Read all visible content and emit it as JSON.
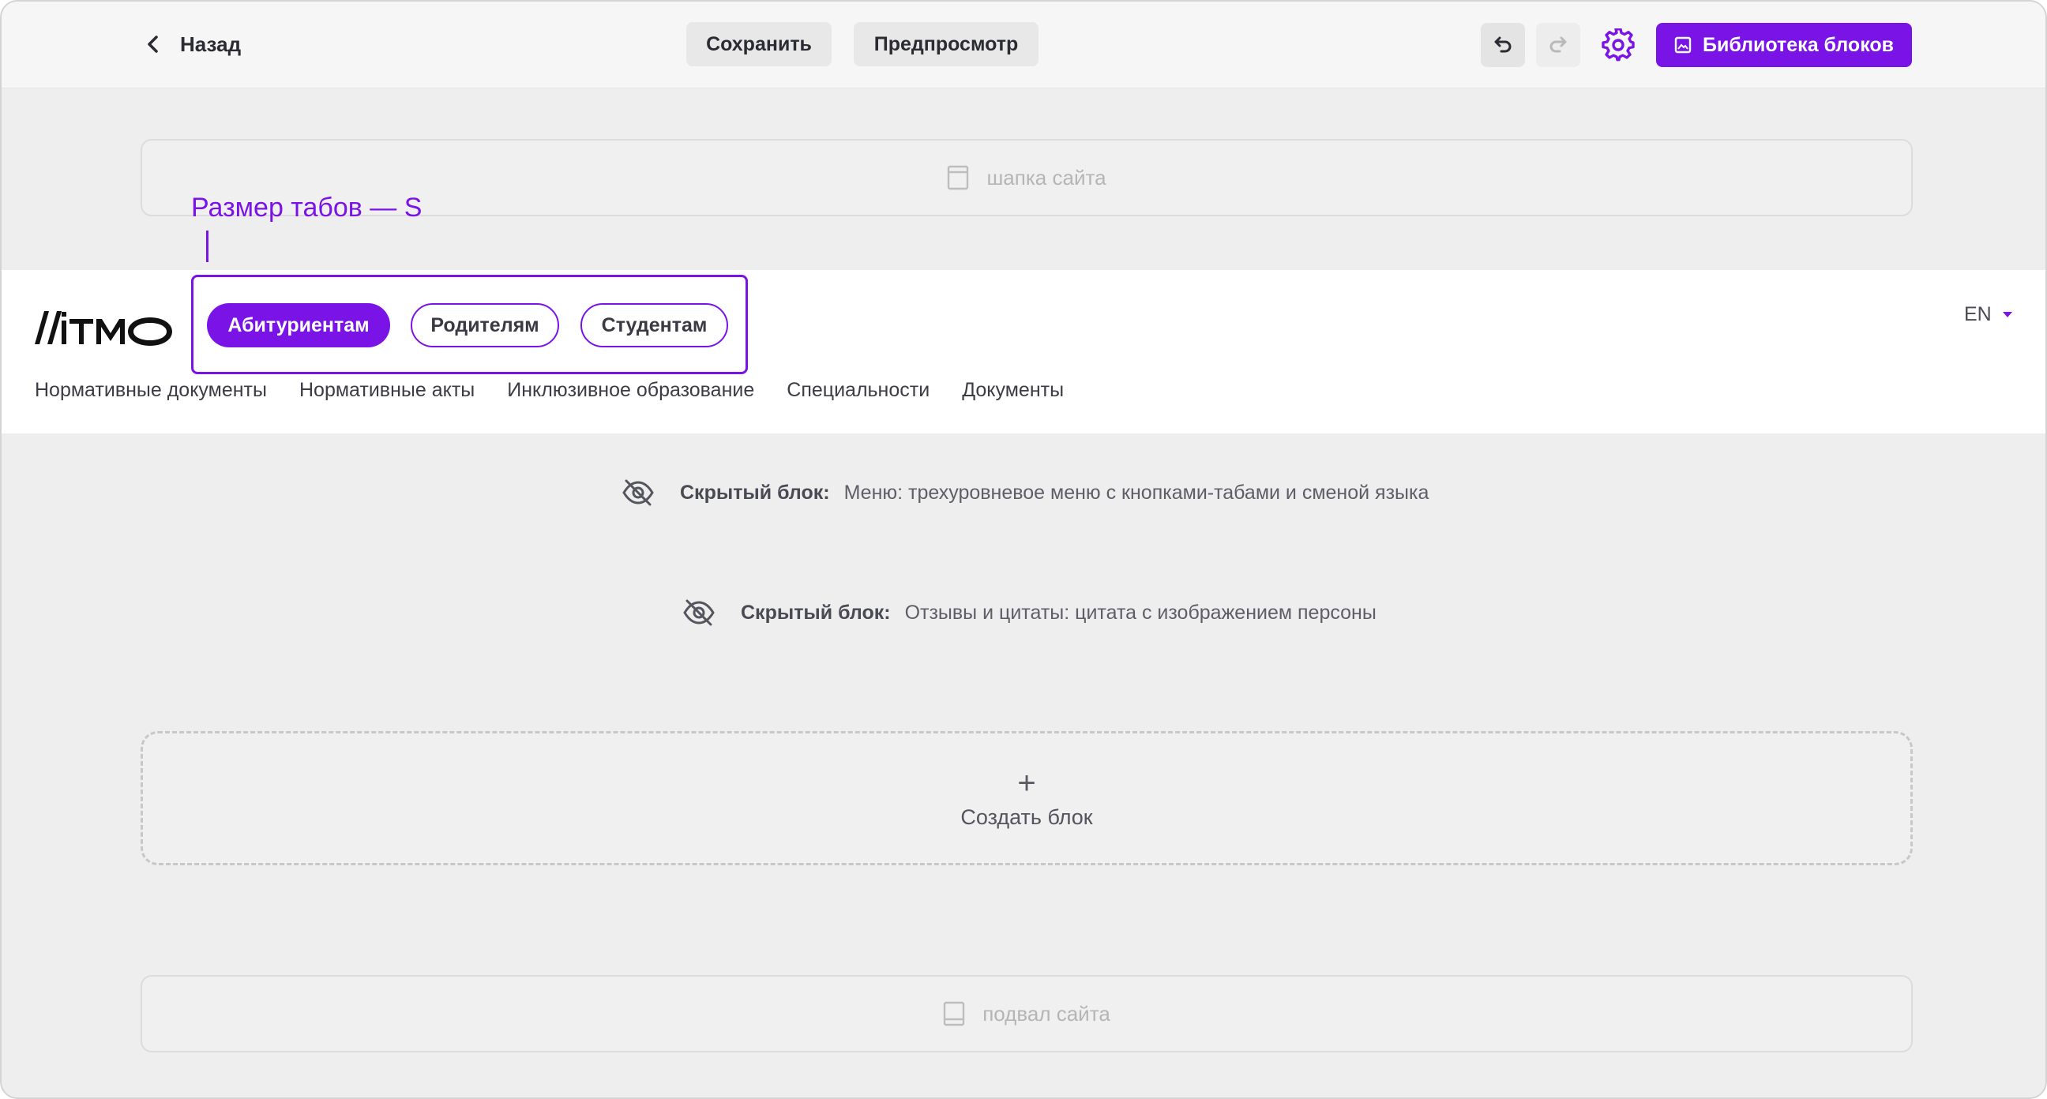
{
  "toolbar": {
    "back_label": "Назад",
    "save_label": "Сохранить",
    "preview_label": "Предпросмотр",
    "library_label": "Библиотека блоков",
    "accent_color": "#7a13e6"
  },
  "placeholders": {
    "header": "шапка сайта",
    "footer": "подвал сайта"
  },
  "annotation": {
    "text": "Размер табов — S"
  },
  "site_menu": {
    "tabs": [
      {
        "label": "Абитуриентам",
        "active": true
      },
      {
        "label": "Родителям",
        "active": false
      },
      {
        "label": "Студентам",
        "active": false
      }
    ],
    "language": "EN",
    "nav": [
      "Нормативные документы",
      "Нормативные акты",
      "Инклюзивное образование",
      "Специальности",
      "Документы"
    ]
  },
  "hidden_blocks": [
    {
      "label": "Скрытый блок:",
      "description": "Меню: трехуровневое меню с кнопками-табами и сменой языка"
    },
    {
      "label": "Скрытый блок:",
      "description": "Отзывы и цитаты: цитата с изображением персоны"
    }
  ],
  "create_block": {
    "icon": "+",
    "label": "Создать блок"
  }
}
